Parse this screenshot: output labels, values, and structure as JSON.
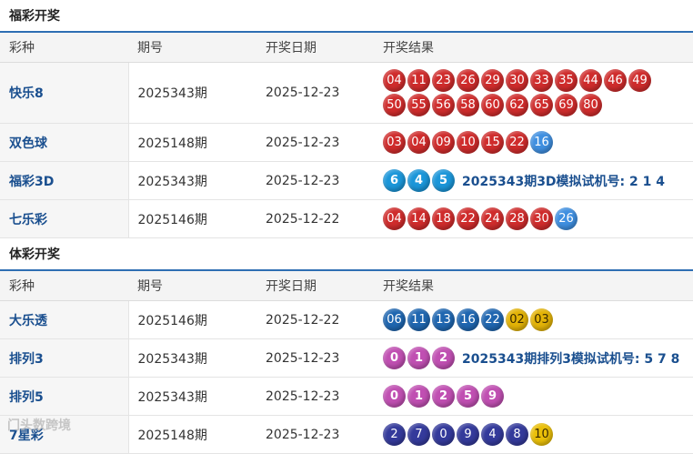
{
  "fucai": {
    "title": "福彩开奖",
    "headers": {
      "type": "彩种",
      "issue": "期号",
      "date": "开奖日期",
      "result": "开奖结果"
    },
    "rows": [
      {
        "name": "快乐8",
        "issue": "2025343期",
        "date": "2025-12-23",
        "red": [
          "04",
          "11",
          "23",
          "26",
          "29",
          "30",
          "33",
          "35",
          "44",
          "46",
          "49",
          "50",
          "55",
          "56",
          "58",
          "60",
          "62",
          "65",
          "69",
          "80"
        ]
      },
      {
        "name": "双色球",
        "issue": "2025148期",
        "date": "2025-12-23",
        "red": [
          "03",
          "04",
          "09",
          "10",
          "15",
          "22"
        ],
        "blue": [
          "16"
        ]
      },
      {
        "name": "福彩3D",
        "issue": "2025343期",
        "date": "2025-12-23",
        "balls": [
          "6",
          "4",
          "5"
        ],
        "trial": "2025343期3D模拟试机号: 2 1 4"
      },
      {
        "name": "七乐彩",
        "issue": "2025146期",
        "date": "2025-12-22",
        "red": [
          "04",
          "14",
          "18",
          "22",
          "24",
          "28",
          "30"
        ],
        "blue": [
          "26"
        ]
      }
    ]
  },
  "ticai": {
    "title": "体彩开奖",
    "headers": {
      "type": "彩种",
      "issue": "期号",
      "date": "开奖日期",
      "result": "开奖结果"
    },
    "rows": [
      {
        "name": "大乐透",
        "issue": "2025146期",
        "date": "2025-12-22",
        "front": [
          "06",
          "11",
          "13",
          "16",
          "22"
        ],
        "back": [
          "02",
          "03"
        ]
      },
      {
        "name": "排列3",
        "issue": "2025343期",
        "date": "2025-12-23",
        "balls": [
          "0",
          "1",
          "2"
        ],
        "trial": "2025343期排列3模拟试机号: 5 7 8"
      },
      {
        "name": "排列5",
        "issue": "2025343期",
        "date": "2025-12-23",
        "balls": [
          "0",
          "1",
          "2",
          "5",
          "9"
        ]
      },
      {
        "name": "7星彩",
        "issue": "2025148期",
        "date": "2025-12-23",
        "balls": [
          "2",
          "7",
          "0",
          "9",
          "4",
          "8"
        ],
        "special": [
          "10"
        ]
      }
    ]
  },
  "watermark": "门头数跨境",
  "colors": {
    "header_rule": "#2e6eb3",
    "link": "#1a4f8f",
    "red_ball": "#cf2c2c",
    "blue_ball": "#3f8fe0",
    "3d_ball": "#1b96d9",
    "pl_ball": "#c04fb2",
    "dlt_front": "#1f66b0",
    "dlt_back": "#e3b307",
    "qxc_ball": "#343a9b",
    "qxc_special": "#eabf09"
  }
}
